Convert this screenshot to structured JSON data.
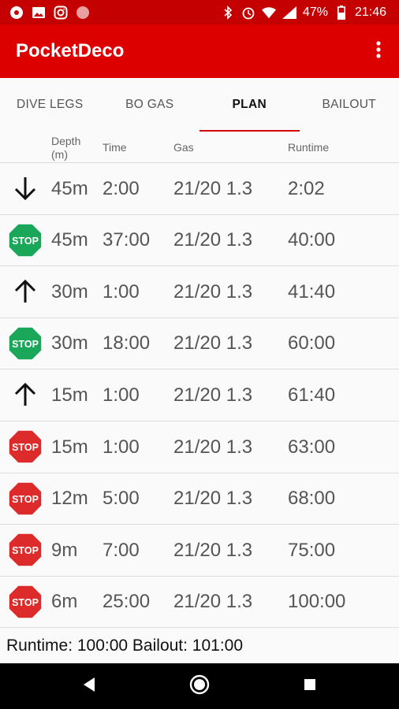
{
  "status_bar": {
    "battery": "47%",
    "time": "21:46",
    "icons": [
      "app-notification-icon",
      "image-icon",
      "instagram-icon",
      "circle-icon",
      "bluetooth-icon",
      "alarm-icon",
      "wifi-icon",
      "signal-icon",
      "battery-icon"
    ]
  },
  "app_bar": {
    "title": "PocketDeco",
    "menu_icon": "more-vert-icon"
  },
  "tabs": [
    {
      "label": "DIVE LEGS",
      "active": false
    },
    {
      "label": "BO GAS",
      "active": false
    },
    {
      "label": "PLAN",
      "active": true
    },
    {
      "label": "BAILOUT",
      "active": false
    }
  ],
  "columns": {
    "depth": "Depth\n(m)",
    "time": "Time",
    "gas": "Gas",
    "runtime": "Runtime"
  },
  "rows": [
    {
      "icon": "arrow-down-icon",
      "depth": "45m",
      "time": "2:00",
      "gas": "21/20 1.3",
      "runtime": "2:02"
    },
    {
      "icon": "stop-green-icon",
      "depth": "45m",
      "time": "37:00",
      "gas": "21/20 1.3",
      "runtime": "40:00"
    },
    {
      "icon": "arrow-up-icon",
      "depth": "30m",
      "time": "1:00",
      "gas": "21/20 1.3",
      "runtime": "41:40"
    },
    {
      "icon": "stop-green-icon",
      "depth": "30m",
      "time": "18:00",
      "gas": "21/20 1.3",
      "runtime": "60:00"
    },
    {
      "icon": "arrow-up-icon",
      "depth": "15m",
      "time": "1:00",
      "gas": "21/20 1.3",
      "runtime": "61:40"
    },
    {
      "icon": "stop-red-icon",
      "depth": "15m",
      "time": "1:00",
      "gas": "21/20 1.3",
      "runtime": "63:00"
    },
    {
      "icon": "stop-red-icon",
      "depth": "12m",
      "time": "5:00",
      "gas": "21/20 1.3",
      "runtime": "68:00"
    },
    {
      "icon": "stop-red-icon",
      "depth": "9m",
      "time": "7:00",
      "gas": "21/20 1.3",
      "runtime": "75:00"
    },
    {
      "icon": "stop-red-icon",
      "depth": "6m",
      "time": "25:00",
      "gas": "21/20 1.3",
      "runtime": "100:00"
    }
  ],
  "stop_label": "STOP",
  "colors": {
    "green_stop": "#1aa75a",
    "red_stop": "#dd2a2a",
    "accent": "#dd0000"
  },
  "footer": {
    "summary": "Runtime: 100:00 Bailout: 101:00"
  },
  "nav": {
    "back": "back-icon",
    "home": "home-icon",
    "recents": "recents-icon"
  }
}
